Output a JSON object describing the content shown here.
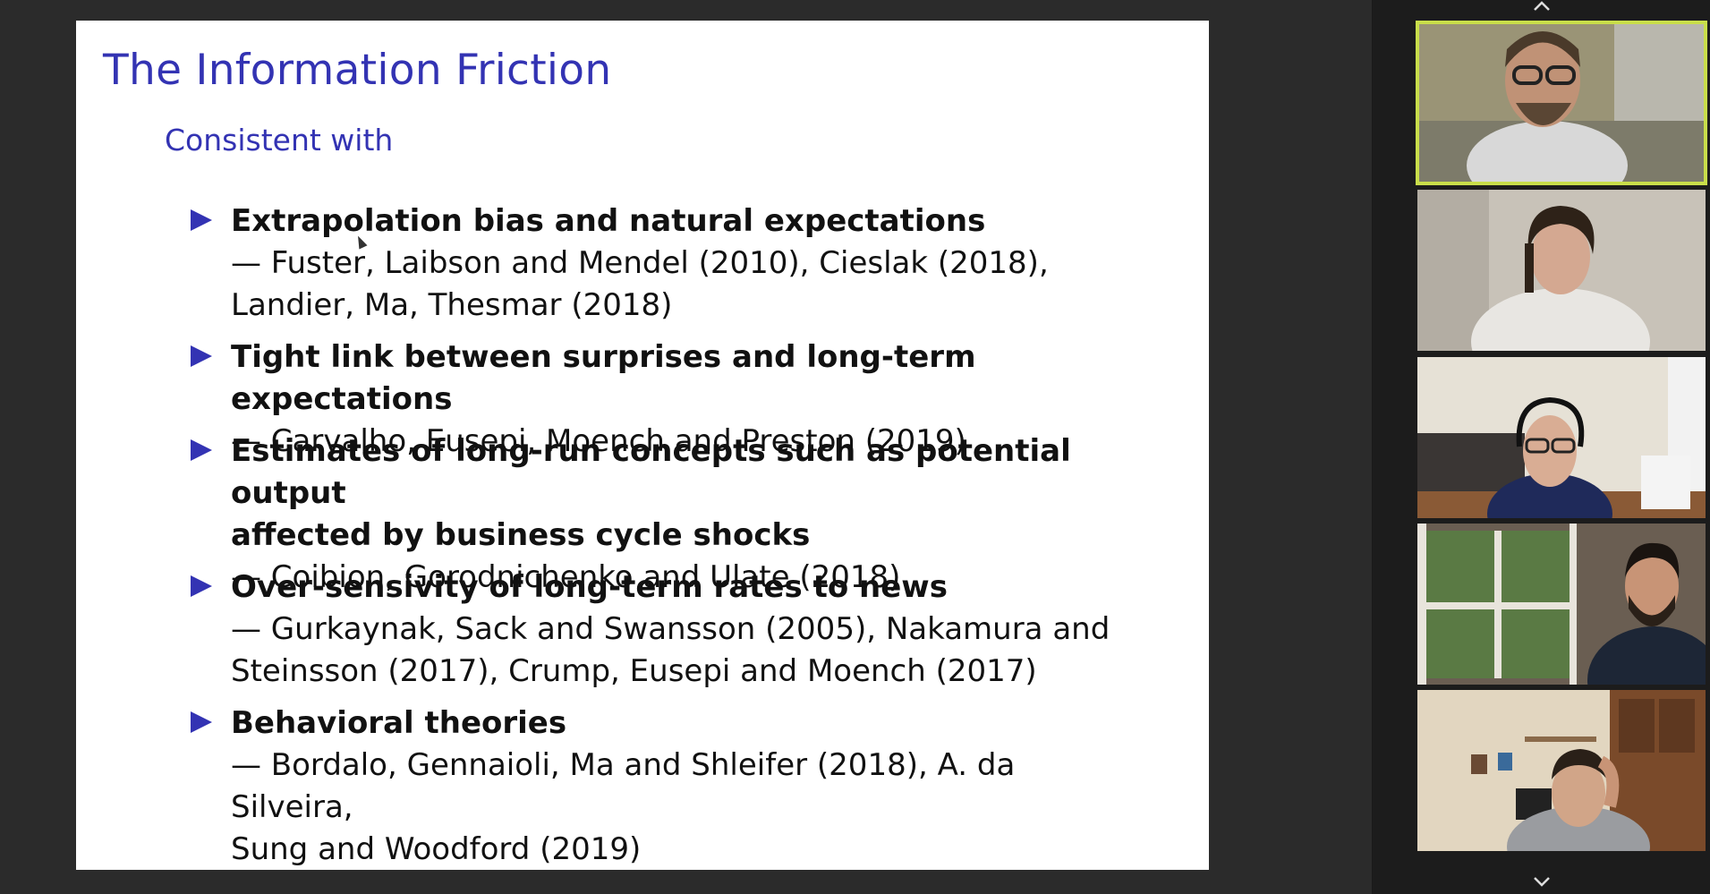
{
  "slide": {
    "title": "The Information Friction",
    "subtitle": "Consistent with",
    "bullets": [
      {
        "heading": "Extrapolation bias and natural expectations",
        "refs": [
          "— Fuster, Laibson and Mendel (2010), Cieslak (2018),",
          "Landier, Ma, Thesmar (2018)"
        ]
      },
      {
        "heading": "Tight link between surprises and long-term expectations",
        "refs": [
          "— Carvalho, Eusepi, Moench and Preston (2019)"
        ]
      },
      {
        "heading_lines": [
          "Estimates of long-run concepts such as potential output",
          "affected by business cycle shocks"
        ],
        "refs": [
          "— Coibion, Gorodnichenko and Ulate (2018)"
        ]
      },
      {
        "heading": "Over-sensivity of long-term rates to news",
        "refs": [
          "— Gurkaynak, Sack and Swansson (2005), Nakamura and",
          "Steinsson (2017), Crump, Eusepi and Moench (2017)"
        ]
      },
      {
        "heading": "Behavioral theories",
        "refs": [
          "— Bordalo, Gennaioli, Ma and Shleifer (2018), A. da Silveira,",
          "Sung and Woodford (2019)"
        ]
      }
    ]
  },
  "gallery": {
    "scroll_up_icon": "chevron-up-icon",
    "scroll_down_icon": "chevron-down-icon",
    "active_speaker_color": "#c9de4a",
    "tiles": [
      "participant-video-1",
      "participant-video-2",
      "participant-video-3",
      "participant-video-4",
      "participant-video-5"
    ]
  }
}
